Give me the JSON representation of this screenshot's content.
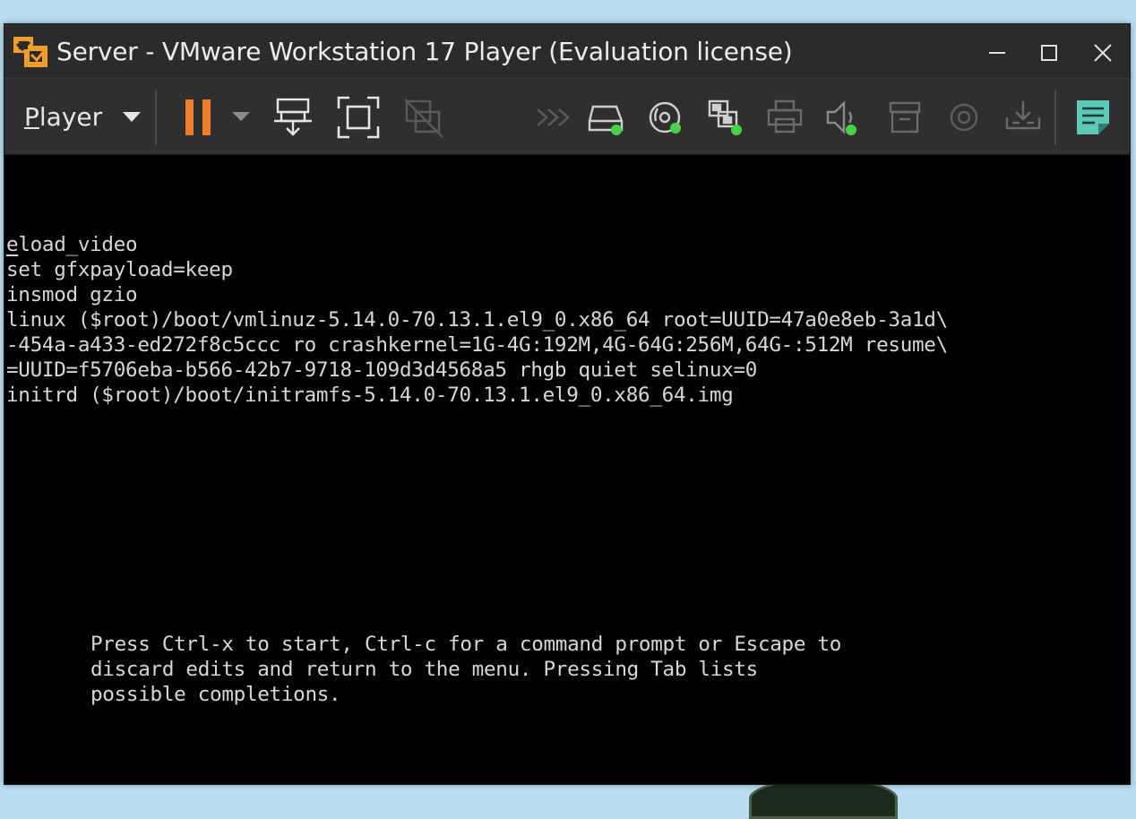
{
  "window": {
    "title": "Server - VMware Workstation 17 Player (Evaluation license)"
  },
  "window_controls": [
    {
      "name": "minimize-button",
      "icon": "minimize-icon"
    },
    {
      "name": "maximize-button",
      "icon": "maximize-icon"
    },
    {
      "name": "close-button",
      "icon": "close-icon"
    }
  ],
  "toolbar": {
    "player_menu_label": "Player",
    "player_menu_hotkey": "P",
    "player_menu_rest": "layer",
    "icons": [
      "pause-icon",
      "power-dropdown-icon",
      "send-ctrl-alt-del-icon",
      "full-screen-icon",
      "unity-icon",
      "more-devices-icon",
      "hard-disk-icon",
      "cd-dvd-icon",
      "network-adapter-icon",
      "printer-icon",
      "sound-card-icon",
      "usb-storage-icon",
      "camera-icon",
      "removable-devices-icon",
      "message-log-icon"
    ],
    "accent_color": "#f07d2b",
    "active_dot_color": "#4ad04a"
  },
  "console": {
    "grub_lines": [
      "load_video",
      "set gfxpayload=keep",
      "insmod gzio",
      "linux ($root)/boot/vmlinuz-5.14.0-70.13.1.el9_0.x86_64 root=UUID=47a0e8eb-3a1d\\",
      "-454a-a433-ed272f8c5ccc ro crashkernel=1G-4G:192M,4G-64G:256M,64G-:512M resume\\",
      "=UUID=f5706eba-b566-42b7-9718-109d3d4568a5 rhgb quiet selinux=0",
      "initrd ($root)/boot/initramfs-5.14.0-70.13.1.el9_0.x86_64.img"
    ],
    "first_line_cursor_char": "e",
    "first_line_rest": "load_video",
    "help_lines": [
      "Press Ctrl-x to start, Ctrl-c for a command prompt or Escape to",
      "discard edits and return to the menu. Pressing Tab lists",
      "possible completions."
    ]
  }
}
